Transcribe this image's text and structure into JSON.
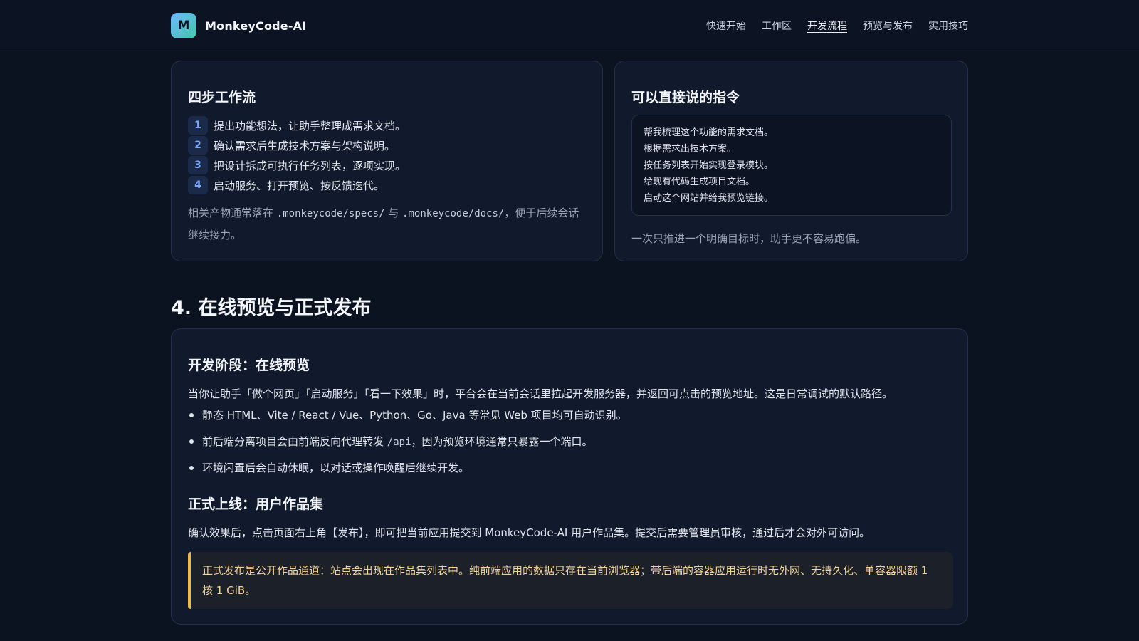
{
  "header": {
    "logo_letter": "M",
    "brand": "MonkeyCode-AI",
    "nav": [
      {
        "label": "快速开始",
        "active": false
      },
      {
        "label": "工作区",
        "active": false
      },
      {
        "label": "开发流程",
        "active": true
      },
      {
        "label": "预览与发布",
        "active": false
      },
      {
        "label": "实用技巧",
        "active": false
      }
    ]
  },
  "workflow": {
    "title": "四步工作流",
    "steps": [
      {
        "num": "1",
        "text": "提出功能想法，让助手整理成需求文档。"
      },
      {
        "num": "2",
        "text": "确认需求后生成技术方案与架构说明。"
      },
      {
        "num": "3",
        "text": "把设计拆成可执行任务列表，逐项实现。"
      },
      {
        "num": "4",
        "text": "启动服务、打开预览、按反馈迭代。"
      }
    ],
    "note_prefix": "相关产物通常落在 ",
    "note_path1": ".monkeycode/specs/",
    "note_mid": " 与 ",
    "note_path2": ".monkeycode/docs/",
    "note_suffix": "，便于后续会话继续接力。"
  },
  "commands": {
    "title": "可以直接说的指令",
    "items": [
      "帮我梳理这个功能的需求文档。",
      "根据需求出技术方案。",
      "按任务列表开始实现登录模块。",
      "给现有代码生成项目文档。",
      "启动这个网站并给我预览链接。"
    ],
    "note": "一次只推进一个明确目标时，助手更不容易跑偏。"
  },
  "section": {
    "title": "4. 在线预览与正式发布"
  },
  "preview": {
    "dev_title": "开发阶段：在线预览",
    "dev_para": "当你让助手「做个网页」「启动服务」「看一下效果」时，平台会在当前会话里拉起开发服务器，并返回可点击的预览地址。这是日常调试的默认路径。",
    "bullet1": "静态 HTML、Vite / React / Vue、Python、Go、Java 等常见 Web 项目均可自动识别。",
    "bullet2_prefix": "前后端分离项目会由前端反向代理转发 ",
    "bullet2_code": "/api",
    "bullet2_suffix": "，因为预览环境通常只暴露一个端口。",
    "bullet3": "环境闲置后会自动休眠，以对话或操作唤醒后继续开发。",
    "pub_title": "正式上线：用户作品集",
    "pub_para": "确认效果后，点击页面右上角【发布】，即可把当前应用提交到 MonkeyCode-AI 用户作品集。提交后需要管理员审核，通过后才会对外可访问。",
    "warning": "正式发布是公开作品通道：站点会出现在作品集列表中。纯前端应用的数据只存在当前浏览器；带后端的容器应用运行时无外网、无持久化、单容器限额 1 核 1 GiB。"
  }
}
